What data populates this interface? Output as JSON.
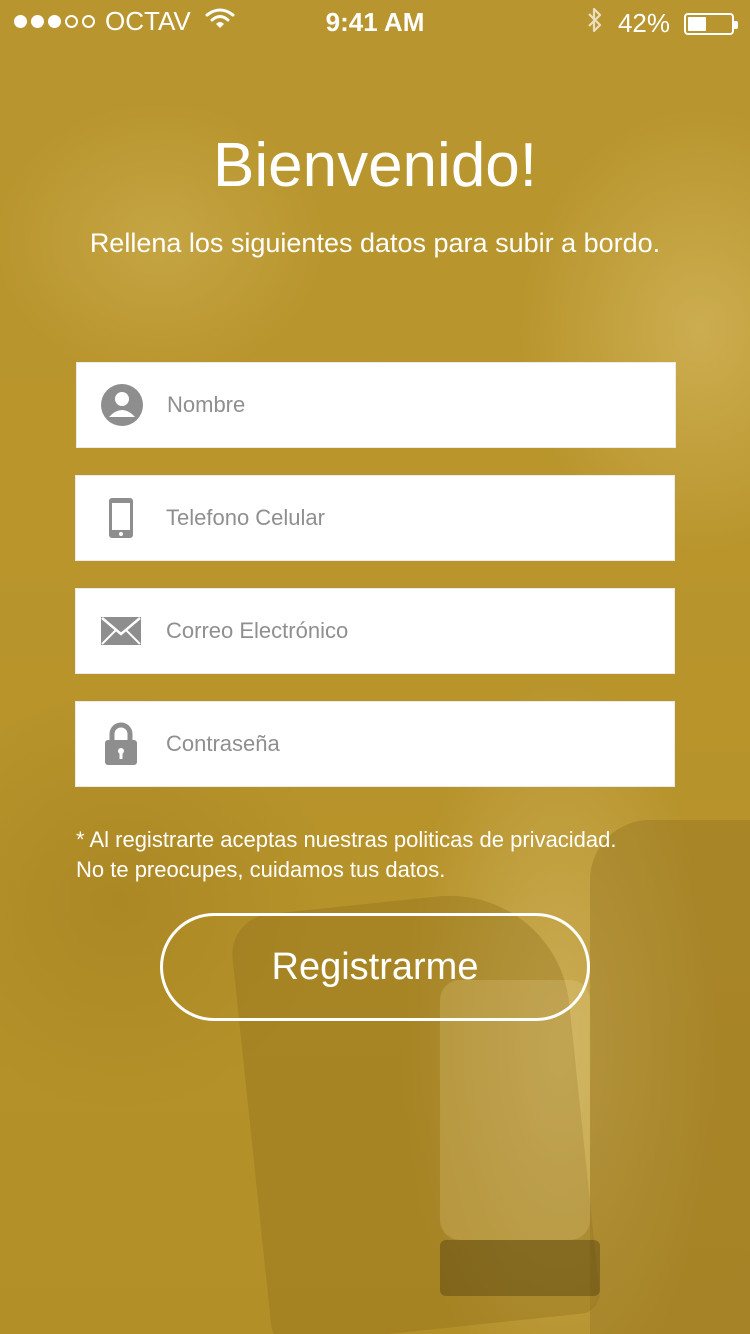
{
  "status_bar": {
    "signal_bars_filled": 3,
    "signal_bars_total": 5,
    "carrier": "OCTAV",
    "wifi_icon": "wifi-icon",
    "time": "9:41 AM",
    "bluetooth_icon": "bluetooth-icon",
    "battery_percent_label": "42%",
    "battery_level": 0.42
  },
  "header": {
    "title": "Bienvenido!",
    "subtitle": "Rellena los siguientes datos para subir a bordo."
  },
  "form": {
    "fields": [
      {
        "icon": "user-icon",
        "placeholder": "Nombre",
        "value": ""
      },
      {
        "icon": "phone-icon",
        "placeholder": "Telefono Celular",
        "value": ""
      },
      {
        "icon": "mail-icon",
        "placeholder": "Correo Electrónico",
        "value": ""
      },
      {
        "icon": "lock-icon",
        "placeholder": "Contraseña",
        "value": ""
      }
    ],
    "note_line1": "* Al registrarte aceptas nuestras politicas de privacidad.",
    "note_line2": "No te preocupes, cuidamos tus datos.",
    "submit_label": "Registrarme"
  },
  "colors": {
    "background_tint": "#B8952C",
    "text": "#FFFFFF",
    "field_background": "#FFFFFF",
    "icon": "#8E8E8E",
    "placeholder": "#8F8F8F"
  }
}
